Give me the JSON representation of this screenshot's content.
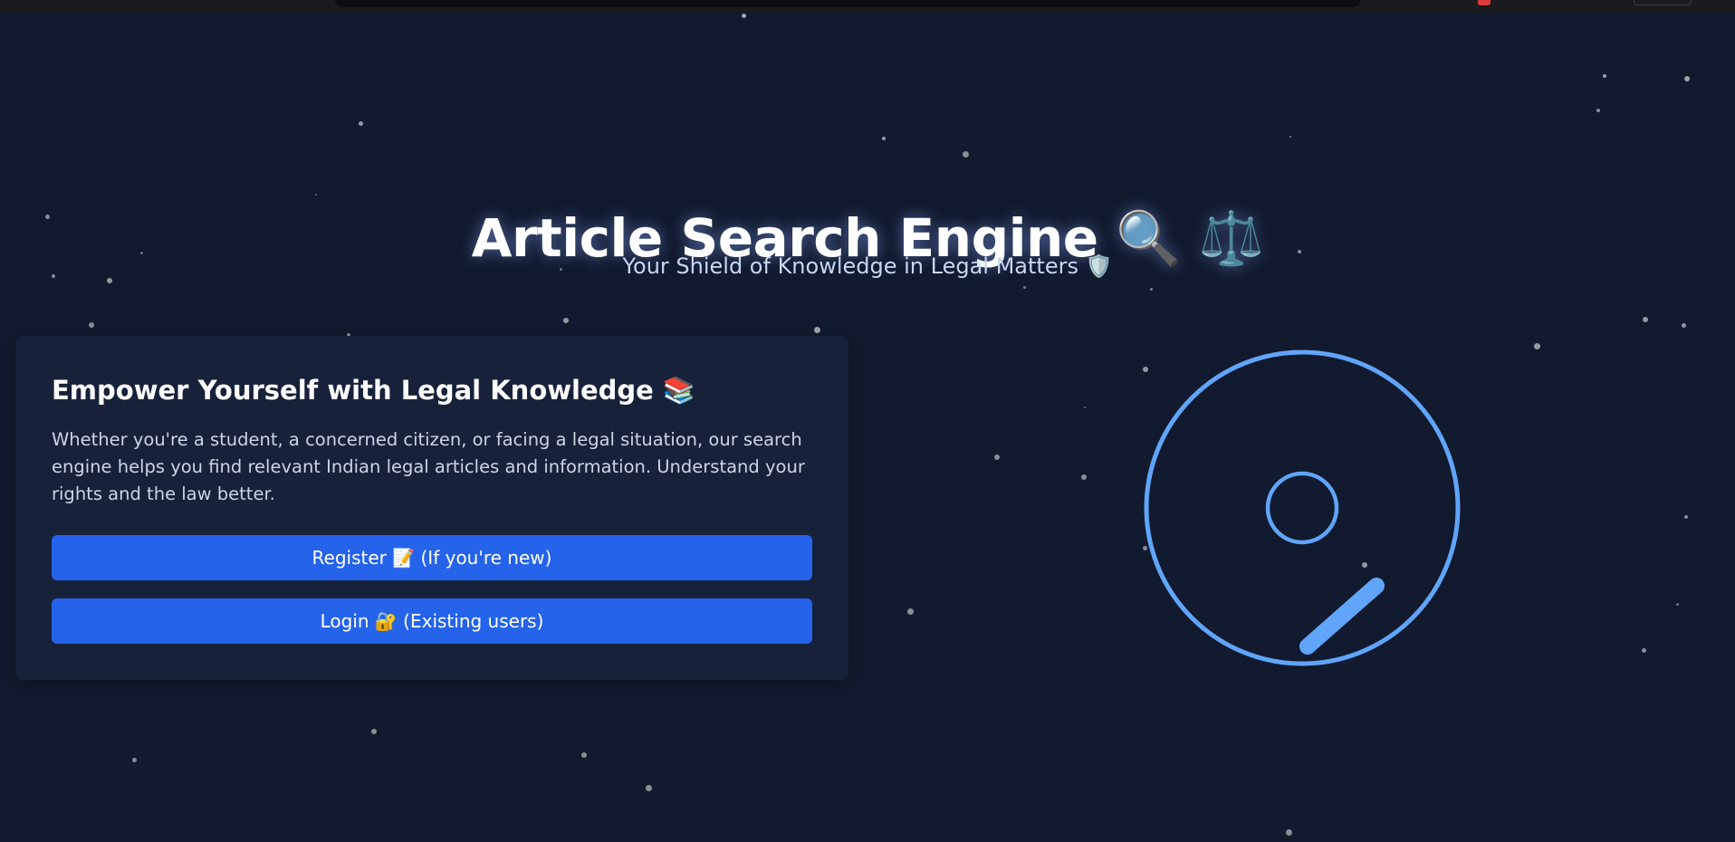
{
  "hero": {
    "title": "Article Search Engine 🔍 ⚖️",
    "subtitle": "Your Shield of Knowledge in Legal Matters 🛡️"
  },
  "intro_card": {
    "heading": "Empower Yourself with Legal Knowledge 📚",
    "body": "Whether you're a student, a concerned citizen, or facing a legal situation, our search engine helps you find relevant Indian legal articles and information. Understand your rights and the law better.",
    "register_label": "Register 📝 (If you're new)",
    "login_label": "Login 🔐 (Existing users)"
  },
  "illustration": {
    "icon": "magnifier-icon",
    "color": "#60a5fa"
  },
  "colors": {
    "background": "#111a2e",
    "card": "#18213a",
    "button": "#2563eb",
    "accent": "#60a5fa"
  }
}
